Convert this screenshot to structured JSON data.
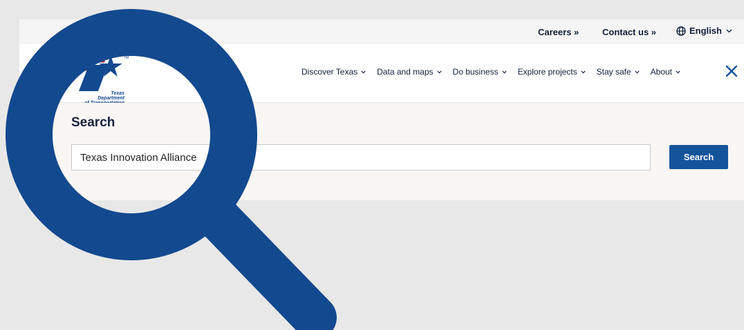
{
  "utility": {
    "careers": "Careers »",
    "contact": "Contact us »",
    "language": "English"
  },
  "logo": {
    "line1": "Texas",
    "line2": "Department",
    "line3": "of Transportation"
  },
  "nav": {
    "items": [
      {
        "label": "Discover Texas"
      },
      {
        "label": "Data and maps"
      },
      {
        "label": "Do business"
      },
      {
        "label": "Explore projects"
      },
      {
        "label": "Stay safe"
      },
      {
        "label": "About"
      }
    ]
  },
  "search": {
    "title": "Search",
    "value": "Texas Innovation Alliance",
    "button_label": "Search"
  },
  "colors": {
    "brand_blue": "#14549a",
    "magnifier_blue": "#13498f",
    "flag_red": "#d8212f"
  },
  "icons": {
    "globe": "globe-icon",
    "chevron": "chevron-down-icon",
    "close": "close-icon",
    "magnifier": "magnifier-icon"
  }
}
